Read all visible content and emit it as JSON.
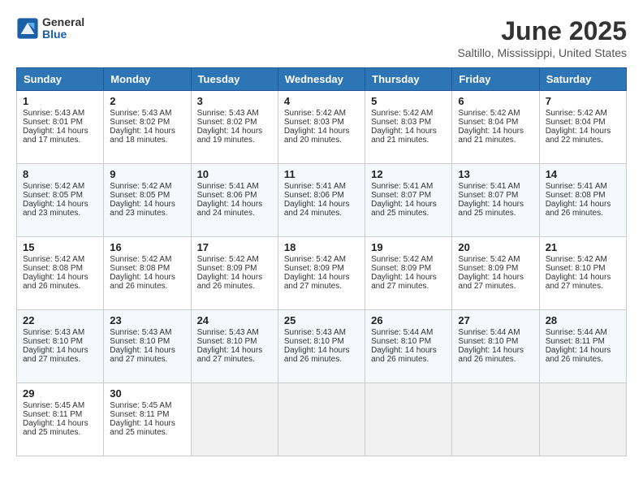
{
  "header": {
    "logo": {
      "general": "General",
      "blue": "Blue"
    },
    "title": "June 2025",
    "subtitle": "Saltillo, Mississippi, United States"
  },
  "calendar": {
    "days": [
      "Sunday",
      "Monday",
      "Tuesday",
      "Wednesday",
      "Thursday",
      "Friday",
      "Saturday"
    ],
    "weeks": [
      [
        {
          "day": 1,
          "sunrise": "5:43 AM",
          "sunset": "8:01 PM",
          "daylight": "14 hours and 17 minutes."
        },
        {
          "day": 2,
          "sunrise": "5:43 AM",
          "sunset": "8:02 PM",
          "daylight": "14 hours and 18 minutes."
        },
        {
          "day": 3,
          "sunrise": "5:43 AM",
          "sunset": "8:02 PM",
          "daylight": "14 hours and 19 minutes."
        },
        {
          "day": 4,
          "sunrise": "5:42 AM",
          "sunset": "8:03 PM",
          "daylight": "14 hours and 20 minutes."
        },
        {
          "day": 5,
          "sunrise": "5:42 AM",
          "sunset": "8:03 PM",
          "daylight": "14 hours and 21 minutes."
        },
        {
          "day": 6,
          "sunrise": "5:42 AM",
          "sunset": "8:04 PM",
          "daylight": "14 hours and 21 minutes."
        },
        {
          "day": 7,
          "sunrise": "5:42 AM",
          "sunset": "8:04 PM",
          "daylight": "14 hours and 22 minutes."
        }
      ],
      [
        {
          "day": 8,
          "sunrise": "5:42 AM",
          "sunset": "8:05 PM",
          "daylight": "14 hours and 23 minutes."
        },
        {
          "day": 9,
          "sunrise": "5:42 AM",
          "sunset": "8:05 PM",
          "daylight": "14 hours and 23 minutes."
        },
        {
          "day": 10,
          "sunrise": "5:41 AM",
          "sunset": "8:06 PM",
          "daylight": "14 hours and 24 minutes."
        },
        {
          "day": 11,
          "sunrise": "5:41 AM",
          "sunset": "8:06 PM",
          "daylight": "14 hours and 24 minutes."
        },
        {
          "day": 12,
          "sunrise": "5:41 AM",
          "sunset": "8:07 PM",
          "daylight": "14 hours and 25 minutes."
        },
        {
          "day": 13,
          "sunrise": "5:41 AM",
          "sunset": "8:07 PM",
          "daylight": "14 hours and 25 minutes."
        },
        {
          "day": 14,
          "sunrise": "5:41 AM",
          "sunset": "8:08 PM",
          "daylight": "14 hours and 26 minutes."
        }
      ],
      [
        {
          "day": 15,
          "sunrise": "5:42 AM",
          "sunset": "8:08 PM",
          "daylight": "14 hours and 26 minutes."
        },
        {
          "day": 16,
          "sunrise": "5:42 AM",
          "sunset": "8:08 PM",
          "daylight": "14 hours and 26 minutes."
        },
        {
          "day": 17,
          "sunrise": "5:42 AM",
          "sunset": "8:09 PM",
          "daylight": "14 hours and 26 minutes."
        },
        {
          "day": 18,
          "sunrise": "5:42 AM",
          "sunset": "8:09 PM",
          "daylight": "14 hours and 27 minutes."
        },
        {
          "day": 19,
          "sunrise": "5:42 AM",
          "sunset": "8:09 PM",
          "daylight": "14 hours and 27 minutes."
        },
        {
          "day": 20,
          "sunrise": "5:42 AM",
          "sunset": "8:09 PM",
          "daylight": "14 hours and 27 minutes."
        },
        {
          "day": 21,
          "sunrise": "5:42 AM",
          "sunset": "8:10 PM",
          "daylight": "14 hours and 27 minutes."
        }
      ],
      [
        {
          "day": 22,
          "sunrise": "5:43 AM",
          "sunset": "8:10 PM",
          "daylight": "14 hours and 27 minutes."
        },
        {
          "day": 23,
          "sunrise": "5:43 AM",
          "sunset": "8:10 PM",
          "daylight": "14 hours and 27 minutes."
        },
        {
          "day": 24,
          "sunrise": "5:43 AM",
          "sunset": "8:10 PM",
          "daylight": "14 hours and 27 minutes."
        },
        {
          "day": 25,
          "sunrise": "5:43 AM",
          "sunset": "8:10 PM",
          "daylight": "14 hours and 26 minutes."
        },
        {
          "day": 26,
          "sunrise": "5:44 AM",
          "sunset": "8:10 PM",
          "daylight": "14 hours and 26 minutes."
        },
        {
          "day": 27,
          "sunrise": "5:44 AM",
          "sunset": "8:10 PM",
          "daylight": "14 hours and 26 minutes."
        },
        {
          "day": 28,
          "sunrise": "5:44 AM",
          "sunset": "8:11 PM",
          "daylight": "14 hours and 26 minutes."
        }
      ],
      [
        {
          "day": 29,
          "sunrise": "5:45 AM",
          "sunset": "8:11 PM",
          "daylight": "14 hours and 25 minutes."
        },
        {
          "day": 30,
          "sunrise": "5:45 AM",
          "sunset": "8:11 PM",
          "daylight": "14 hours and 25 minutes."
        },
        null,
        null,
        null,
        null,
        null
      ]
    ]
  }
}
